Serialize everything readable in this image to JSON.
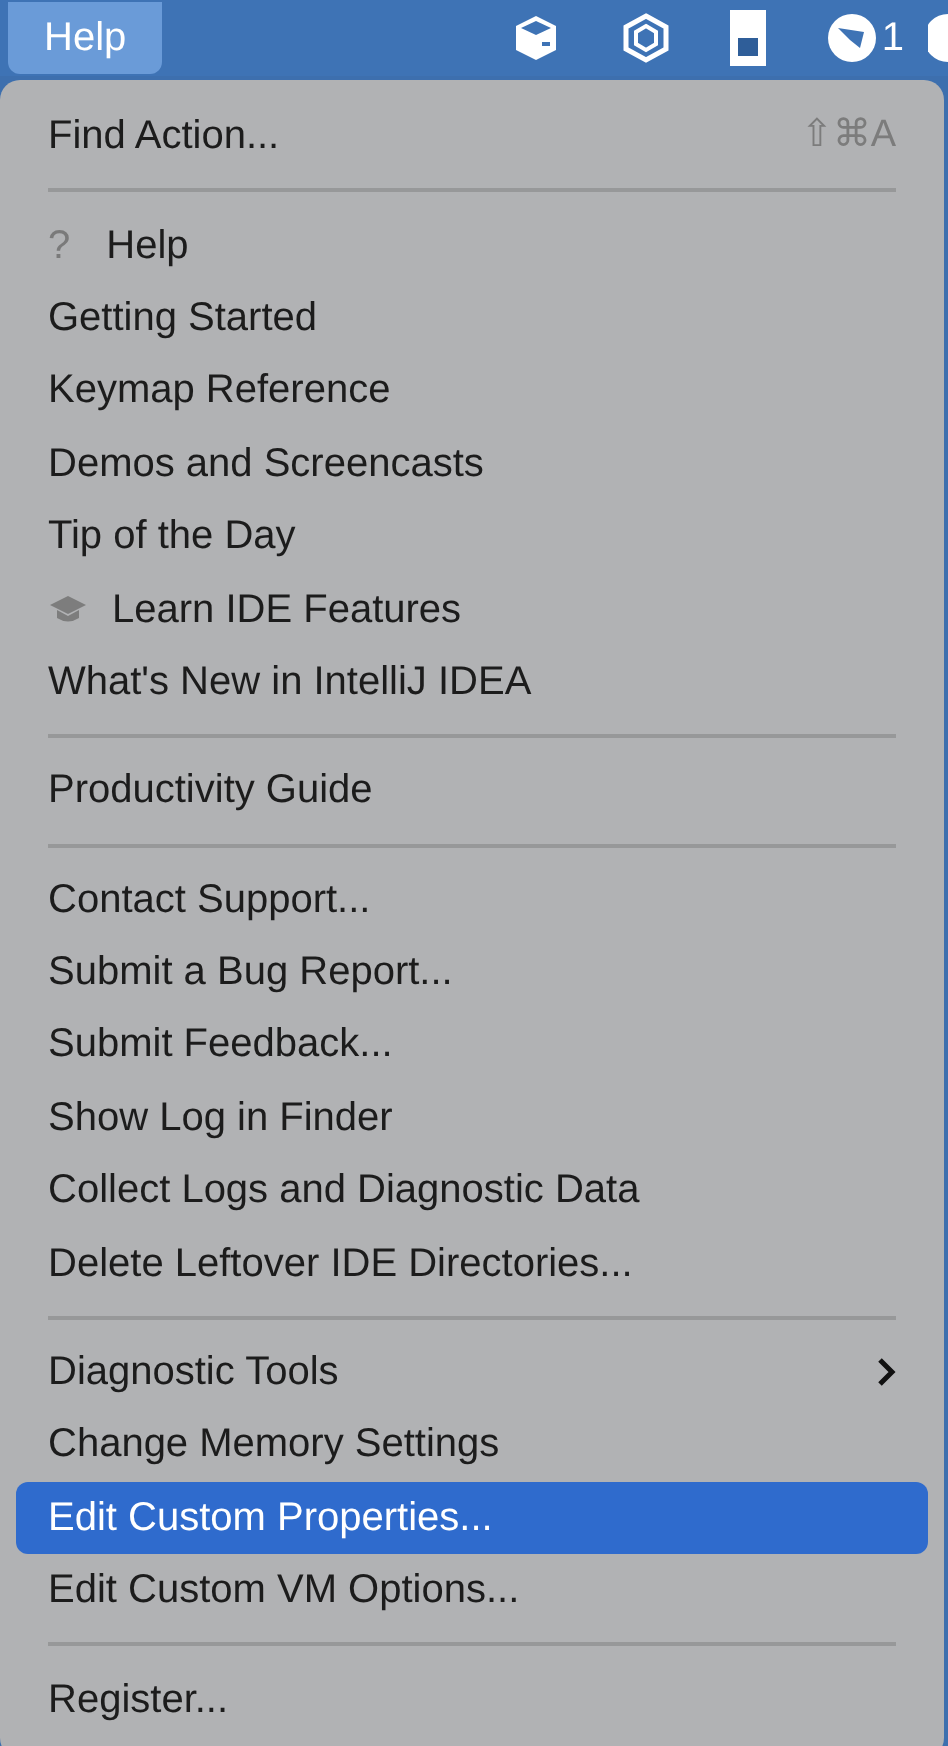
{
  "menu_bar": {
    "menu": {
      "label": "Help",
      "selected": true
    },
    "status_badge": "1"
  },
  "menu": {
    "items": [
      {
        "kind": "item",
        "label": "Find Action...",
        "shortcut": "⇧⌘A",
        "selected": false
      },
      {
        "kind": "separator"
      },
      {
        "kind": "glyph_item",
        "glyph": "?",
        "label": "Help",
        "selected": false
      },
      {
        "kind": "item",
        "label": "Getting Started",
        "selected": false
      },
      {
        "kind": "item",
        "label": "Keymap Reference",
        "selected": false
      },
      {
        "kind": "item",
        "label": "Demos and Screencasts",
        "selected": false
      },
      {
        "kind": "item",
        "label": "Tip of the Day",
        "selected": false
      },
      {
        "kind": "learn_item",
        "label": "Learn IDE Features",
        "selected": false
      },
      {
        "kind": "item",
        "label": "What's New in IntelliJ IDEA",
        "selected": false
      },
      {
        "kind": "separator"
      },
      {
        "kind": "item",
        "label": "Productivity Guide",
        "selected": false
      },
      {
        "kind": "separator"
      },
      {
        "kind": "item",
        "label": "Contact Support...",
        "selected": false
      },
      {
        "kind": "item",
        "label": "Submit a Bug Report...",
        "selected": false
      },
      {
        "kind": "item",
        "label": "Submit Feedback...",
        "selected": false
      },
      {
        "kind": "item",
        "label": "Show Log in Finder",
        "selected": false
      },
      {
        "kind": "item",
        "label": "Collect Logs and Diagnostic Data",
        "selected": false
      },
      {
        "kind": "item",
        "label": "Delete Leftover IDE Directories...",
        "selected": false
      },
      {
        "kind": "separator"
      },
      {
        "kind": "item",
        "label": "Diagnostic Tools",
        "submenu": true,
        "selected": false
      },
      {
        "kind": "item",
        "label": "Change Memory Settings",
        "selected": false
      },
      {
        "kind": "item",
        "label": "Edit Custom Properties...",
        "selected": true
      },
      {
        "kind": "item",
        "label": "Edit Custom VM Options...",
        "selected": false
      },
      {
        "kind": "separator"
      },
      {
        "kind": "item",
        "label": "Register...",
        "selected": false
      }
    ]
  }
}
